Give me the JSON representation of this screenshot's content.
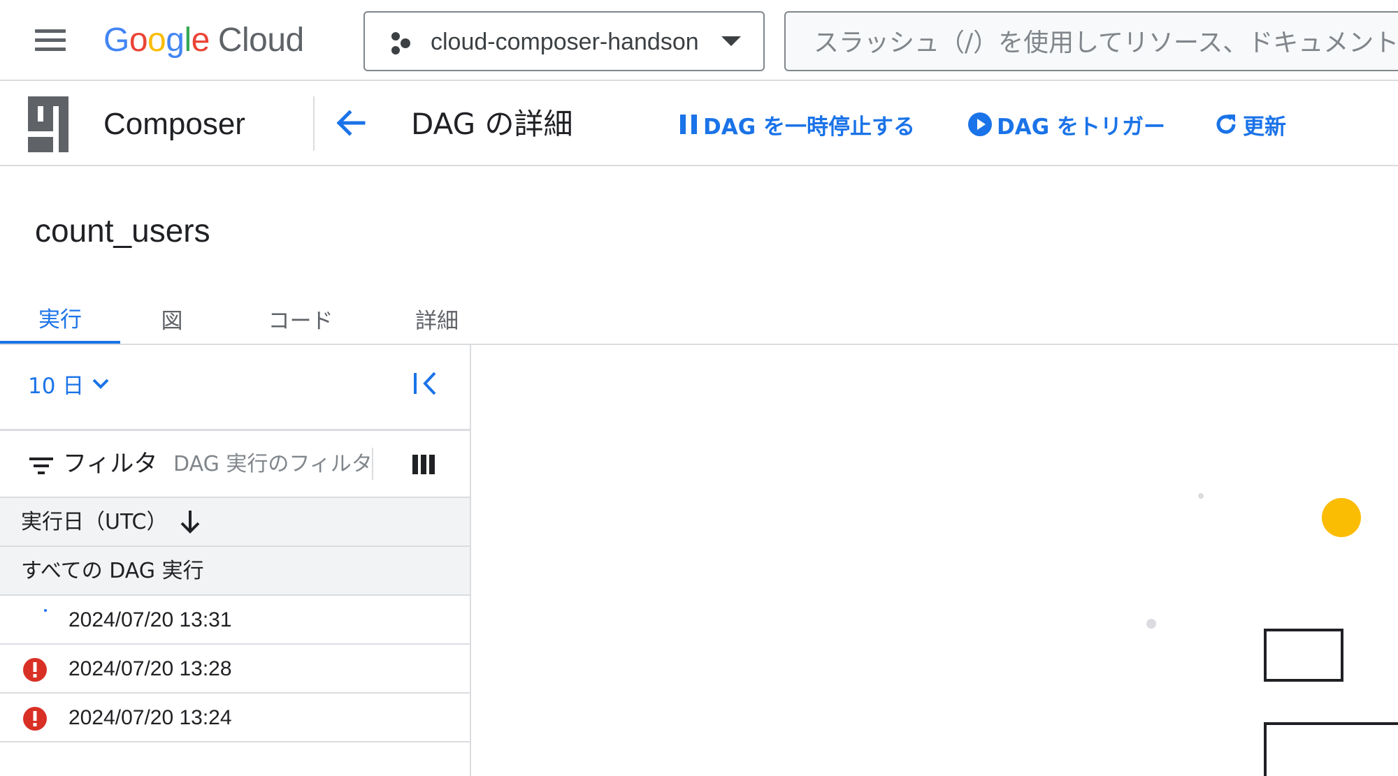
{
  "topbar": {
    "logo": {
      "google": "Google",
      "cloud": "Cloud"
    },
    "project_picker": {
      "label": "cloud-composer-handson"
    },
    "search": {
      "placeholder": "スラッシュ（/）を使用してリソース、ドキュメント"
    }
  },
  "subbar": {
    "product_name": "Composer",
    "page_title": "DAG の詳細",
    "actions": {
      "pause": "DAG を一時停止する",
      "trigger": "DAG をトリガー",
      "refresh": "更新"
    }
  },
  "dag": {
    "name": "count_users"
  },
  "tabs": [
    {
      "label": "実行",
      "active": true
    },
    {
      "label": "図",
      "active": false
    },
    {
      "label": "コード",
      "active": false
    },
    {
      "label": "詳細",
      "active": false
    }
  ],
  "runs_panel": {
    "range": "10 日",
    "filter": {
      "label": "フィルタ",
      "placeholder": "DAG 実行のフィルタ"
    },
    "column_header": "実行日（UTC）",
    "all_runs_label": "すべての DAG 実行",
    "runs": [
      {
        "date": "2024/07/20 13:31",
        "status": "running"
      },
      {
        "date": "2024/07/20 13:28",
        "status": "failed"
      },
      {
        "date": "2024/07/20 13:24",
        "status": "failed"
      }
    ]
  },
  "colors": {
    "accent": "#1a73e8",
    "error": "#d93025",
    "spinner": "#fbbc04",
    "border": "#dadce0"
  }
}
